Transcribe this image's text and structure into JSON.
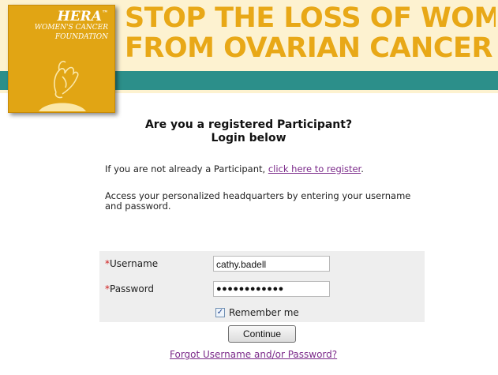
{
  "banner": {
    "headline_line1": "STOP THE LOSS OF WOMEN",
    "headline_line2": "FROM OVARIAN CANCER",
    "colors": {
      "gold": "#e8a817",
      "cream": "#fdf2d0",
      "teal": "#2c8f8a"
    }
  },
  "logo": {
    "name": "HERA",
    "tm": "™",
    "sub_line1": "WOMEN'S CANCER",
    "sub_line2": "FOUNDATION",
    "icon": "hand-flower-icon"
  },
  "login": {
    "title_line1": "Are you a registered Participant?",
    "title_line2": "Login below",
    "register_prefix": "If you are not already a Participant, ",
    "register_link": "click here to register",
    "register_suffix": ".",
    "access_text": "Access your personalized headquarters by entering your username and password.",
    "required_mark": "*",
    "username_label": "Username",
    "username_value": "cathy.badell",
    "password_label": "Password",
    "password_value": "●●●●●●●●●●●●",
    "remember_checked": true,
    "remember_label": "Remember me",
    "continue_label": "Continue",
    "forgot_link": "Forgot Username and/or Password?"
  }
}
